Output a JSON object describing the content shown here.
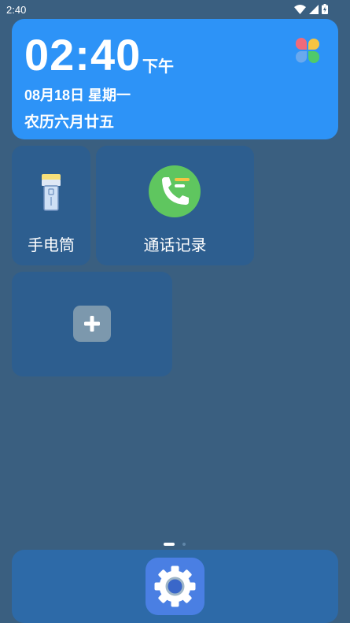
{
  "status_bar": {
    "time": "2:40",
    "icons": [
      "wifi-icon",
      "signal-icon",
      "battery-icon"
    ]
  },
  "clock_widget": {
    "time": "02:40",
    "ampm": "下午",
    "date": "08月18日  星期一",
    "lunar": "农历六月廿五",
    "app_icon": "petal-launcher-icon",
    "background_color": "#2d93f7"
  },
  "tiles": {
    "flashlight": {
      "label": "手电筒",
      "icon": "flashlight-icon"
    },
    "call_log": {
      "label": "通话记录",
      "icon": "phone-call-log-icon"
    },
    "add": {
      "icon": "plus-icon"
    }
  },
  "pager": {
    "page_count": 2,
    "current_page": 1
  },
  "dock": {
    "apps": [
      {
        "icon": "settings-gear-icon"
      }
    ]
  },
  "colors": {
    "background": "#3a5f80",
    "tile": "#2d5e8f",
    "dock": "#2d6aa8",
    "call_green": "#5fc65f",
    "settings_blue": "#4a7fe3"
  }
}
